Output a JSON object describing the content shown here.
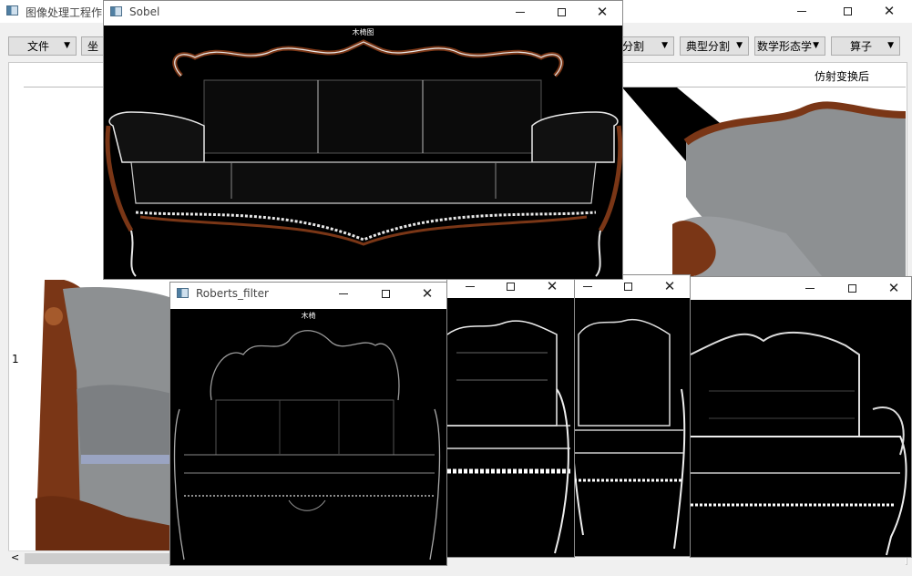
{
  "main_window": {
    "title": "图像处理工程作",
    "minimize": "—",
    "maximize": "☐",
    "close": "✕",
    "menus": {
      "file": "文件",
      "coords": "坐",
      "segment": "像分割",
      "typical_segment": "典型分割",
      "morphology": "数学形态学",
      "operator": "算子"
    },
    "affine_label": "仿射变换后",
    "row_number": "1",
    "scroll_left": "<"
  },
  "sobel_window": {
    "title": "Sobel",
    "caption": "木椅图"
  },
  "roberts_window": {
    "title": "Roberts_filter",
    "caption": "木椅"
  },
  "icons": {
    "app": "window-app-icon",
    "minimize": "minimize-icon",
    "maximize": "maximize-icon",
    "close": "close-icon"
  },
  "colors": {
    "wood": "#7a3616",
    "leather": "#8d9092",
    "edge_white": "#e9e9e9"
  }
}
